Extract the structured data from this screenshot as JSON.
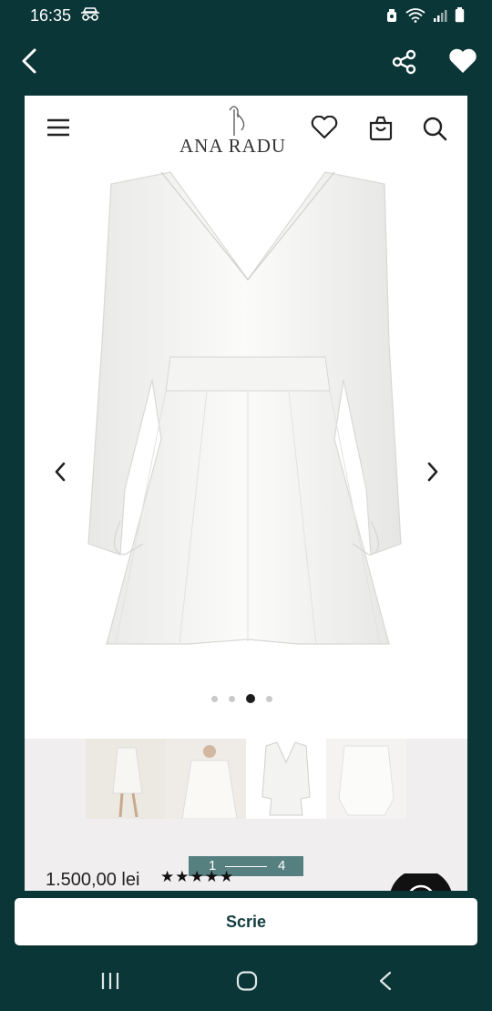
{
  "status_bar": {
    "time": "16:35",
    "icons": [
      "incognito-icon",
      "alarm-icon",
      "wifi-icon",
      "signal-icon",
      "battery-icon"
    ]
  },
  "app_bar": {
    "icons": [
      "back-icon",
      "share-icon",
      "heart-icon"
    ]
  },
  "site": {
    "brand": "ANA RADU",
    "icons": [
      "menu-icon",
      "wishlist-heart-icon",
      "cart-icon",
      "search-icon"
    ]
  },
  "gallery": {
    "current_dot": 3,
    "dot_count": 4,
    "pager_start": "1",
    "pager_end": "4"
  },
  "product": {
    "price": "1.500,00 lei",
    "rating": 5,
    "stars": "★★★★★"
  },
  "actions": {
    "write_label": "Scrie"
  },
  "nav": {
    "icons": [
      "recents-icon",
      "home-icon",
      "back-nav-icon"
    ]
  },
  "colors": {
    "background": "#0b3637",
    "accent": "#567f7f",
    "button_text": "#123c3e"
  }
}
